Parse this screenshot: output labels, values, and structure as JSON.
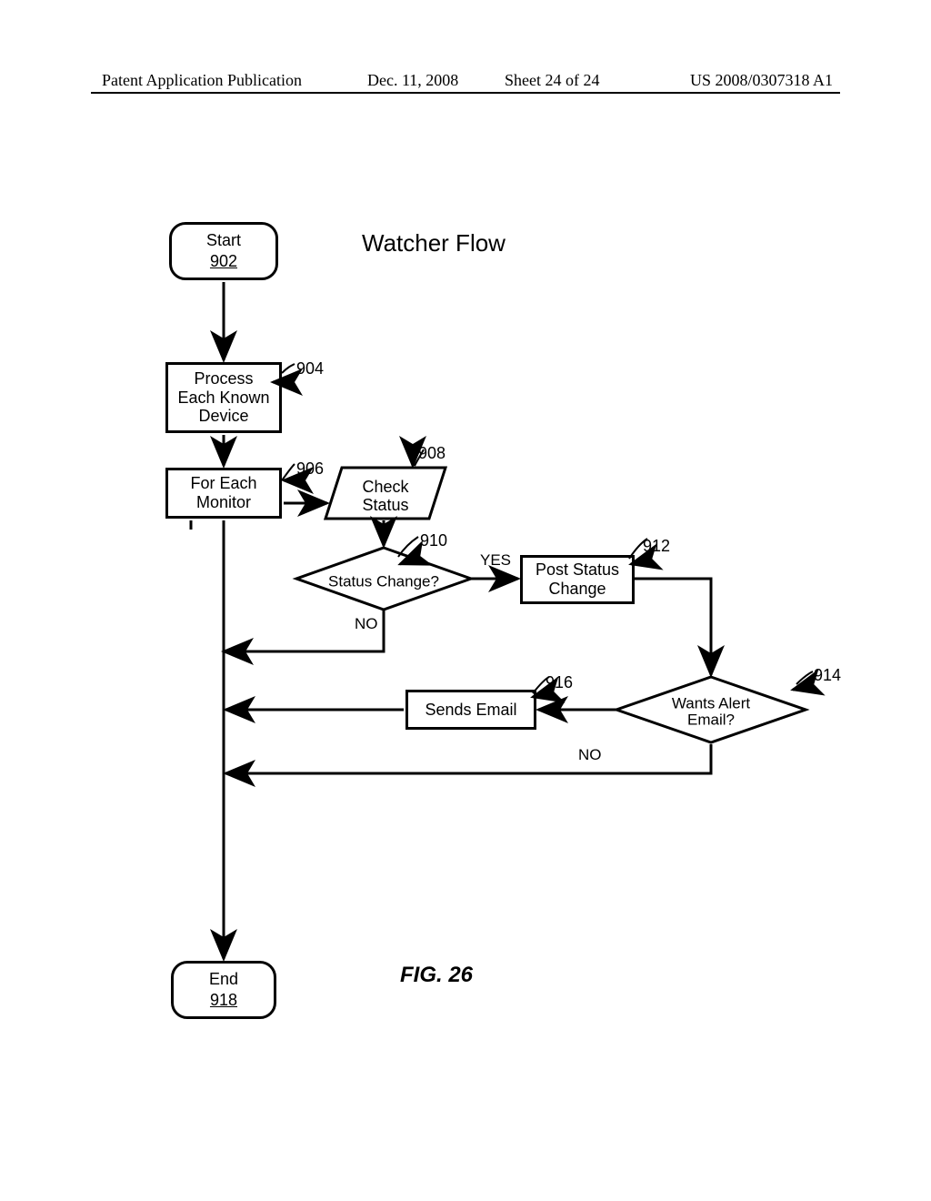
{
  "header": {
    "left": "Patent Application Publication",
    "date": "Dec. 11, 2008",
    "sheet": "Sheet 24 of 24",
    "pubno": "US 2008/0307318 A1"
  },
  "title": "Watcher Flow",
  "figure_label": "FIG. 26",
  "nodes": {
    "start": {
      "label": "Start",
      "ref": "902"
    },
    "process_each": {
      "line1": "Process",
      "line2": "Each Known",
      "line3": "Device",
      "ref": "904"
    },
    "for_each": {
      "line1": "For Each",
      "line2": "Monitor",
      "ref": "906"
    },
    "check_status": {
      "line1": "Check",
      "line2": "Status",
      "ref": "908"
    },
    "status_change": {
      "label": "Status Change?",
      "ref": "910",
      "yes": "YES",
      "no": "NO"
    },
    "post_status": {
      "line1": "Post Status",
      "line2": "Change",
      "ref": "912"
    },
    "wants_email": {
      "line1": "Wants Alert",
      "line2": "Email?",
      "ref": "914",
      "no": "NO"
    },
    "sends_email": {
      "label": "Sends Email",
      "ref": "916"
    },
    "end": {
      "label": "End",
      "ref": "918"
    }
  }
}
